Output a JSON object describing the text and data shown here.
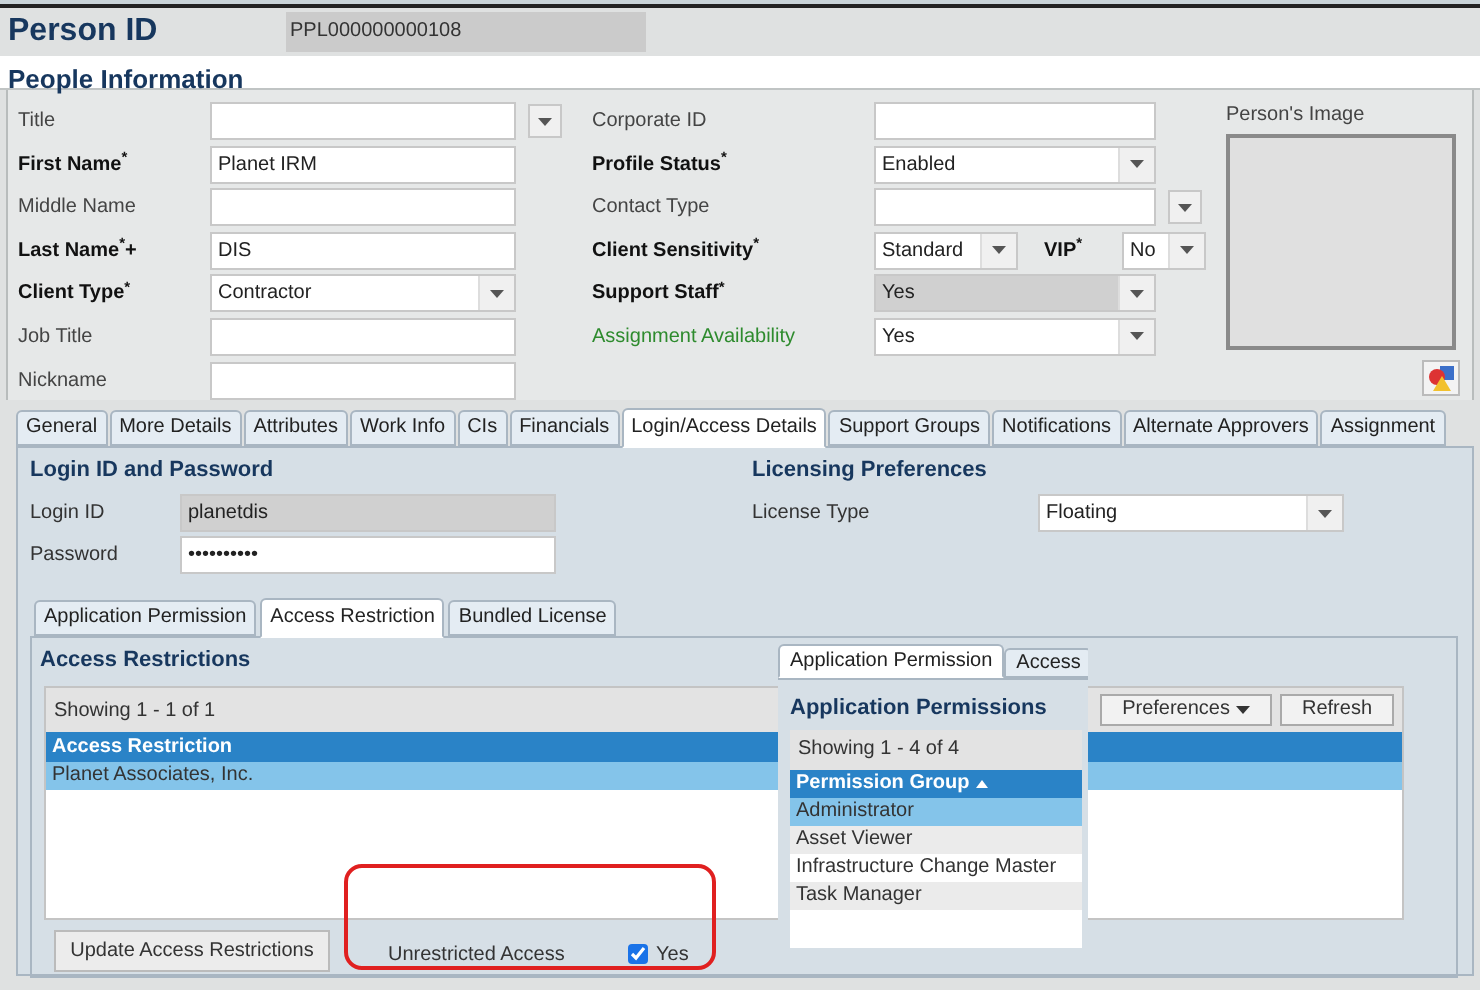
{
  "header": {
    "label": "Person ID",
    "value": "PPL000000000108"
  },
  "section_title": "People Information",
  "left_fields": [
    {
      "label": "Title",
      "required": false,
      "highlighted": false,
      "kind": "text-dropdown"
    },
    {
      "label": "First Name$^{*}$",
      "required": true,
      "highlighted": false,
      "kind": "text",
      "value": "Planet IRM"
    },
    {
      "label": "Middle Name",
      "required": false,
      "highlighted": false,
      "kind": "text"
    },
    {
      "label": "Last Name$^{*}$+",
      "required": true,
      "highlighted": false,
      "kind": "text",
      "value": "DIS"
    },
    {
      "label": "Client Type$^{*}$",
      "required": true,
      "highlighted": false,
      "kind": "select",
      "value": "Contractor"
    },
    {
      "label": "Job Title",
      "required": false,
      "highlighted": false,
      "kind": "text"
    },
    {
      "label": "Nickname",
      "required": false,
      "highlighted": false,
      "kind": "text"
    }
  ],
  "right_fields": [
    {
      "label": "Corporate ID",
      "required": false,
      "highlighted": false,
      "kind": "text",
      "disabled": false
    },
    {
      "label": "Profile Status$^{*}$",
      "required": true,
      "highlighted": false,
      "kind": "select",
      "value": "Enabled",
      "disabled": false
    },
    {
      "label": "Contact Type",
      "required": false,
      "highlighted": false,
      "kind": "text-dropdown",
      "disabled": false
    },
    {
      "label": "Client Sensitivity$^{*}$",
      "required": true,
      "highlighted": false,
      "kind": "select-pair",
      "value": "Standard",
      "disabled": false,
      "pair": {
        "label": "VIP$^{*}$",
        "value": "No"
      }
    },
    {
      "label": "Support Staff$^{*}$",
      "required": true,
      "highlighted": false,
      "kind": "select",
      "value": "Yes",
      "disabled": true
    },
    {
      "label": "Assignment Availability",
      "required": false,
      "highlighted": true,
      "kind": "select",
      "value": "Yes",
      "disabled": false
    }
  ],
  "image": {
    "label": "Person's Image"
  },
  "tabs": [
    {
      "label": "General",
      "selected": false
    },
    {
      "label": "More Details",
      "selected": false
    },
    {
      "label": "Attributes",
      "selected": false
    },
    {
      "label": "Work Info",
      "selected": false
    },
    {
      "label": "CIs",
      "selected": false
    },
    {
      "label": "Financials",
      "selected": false
    },
    {
      "label": "Login/Access Details",
      "selected": true
    },
    {
      "label": "Support Groups",
      "selected": false
    },
    {
      "label": "Notifications",
      "selected": false
    },
    {
      "label": "Alternate Approvers",
      "selected": false
    },
    {
      "label": "Assignment",
      "selected": false
    }
  ],
  "login": {
    "title": "Login ID and Password",
    "fields": [
      {
        "label": "Login ID",
        "value": "planetdis",
        "disabled": true
      },
      {
        "label": "Password",
        "value": "••••••••••",
        "disabled": false
      }
    ]
  },
  "licensing": {
    "title": "Licensing Preferences",
    "label": "License Type",
    "value": "Floating"
  },
  "sub_tabs": [
    {
      "label": "Application Permission",
      "selected": false
    },
    {
      "label": "Access Restriction",
      "selected": true
    },
    {
      "label": "Bundled License",
      "selected": false
    }
  ],
  "access_restrictions": {
    "title": "Access Restrictions",
    "showing": "Showing 1 - 1 of 1",
    "buttons": [
      "Preferences",
      "Refresh"
    ],
    "column": "Access Restriction",
    "rows": [
      {
        "text": "Planet Associates, Inc.",
        "selected": true
      }
    ],
    "update_button": "Update Access Restrictions",
    "unrestricted_label": "Unrestricted Access",
    "unrestricted_checked": true,
    "unrestricted_text": "Yes"
  },
  "popup": {
    "tabs": [
      {
        "label": "Application Permission",
        "selected": true
      },
      {
        "label": "Access",
        "selected": false
      }
    ],
    "title": "Application Permissions",
    "showing": "Showing 1 - 4 of 4",
    "column": "Permission Group",
    "rows": [
      {
        "text": "Administrator",
        "selected": true
      },
      {
        "text": "Asset Viewer",
        "selected": false
      },
      {
        "text": "Infrastructure Change Master",
        "selected": false
      },
      {
        "text": "Task Manager",
        "selected": false
      }
    ]
  }
}
